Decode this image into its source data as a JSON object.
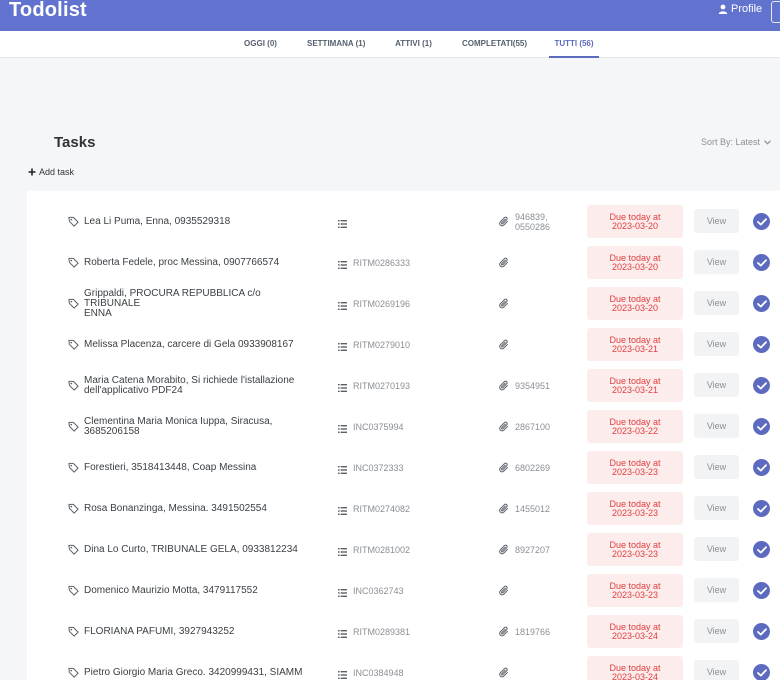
{
  "header": {
    "brand": "Todolist",
    "profile_label": "Profile"
  },
  "tabs": [
    {
      "label": "OGGI (0)",
      "active": false
    },
    {
      "label": "SETTIMANA (1)",
      "active": false
    },
    {
      "label": "ATTIVI (1)",
      "active": false
    },
    {
      "label": "COMPLETATI(55)",
      "active": false
    },
    {
      "label": "TUTTI (56)",
      "active": true
    }
  ],
  "page": {
    "title": "Tasks",
    "sort_label": "Sort By: Latest",
    "add_task_label": "Add task"
  },
  "colors": {
    "accent": "#5c6bc0",
    "topbar": "#6272cf",
    "due_bg": "#fcecec",
    "due_text": "#e03e3e"
  },
  "icons": [
    "user-icon",
    "chevron-down-icon",
    "plus-icon",
    "tag-icon",
    "list-icon",
    "paperclip-icon",
    "check-circle-icon"
  ],
  "tasks": [
    {
      "name_lines": [
        "Lea Li Puma, Enna, 0935529318"
      ],
      "code": "",
      "ref_lines": [
        "946839,",
        "0550286"
      ],
      "due_label": "Due today at",
      "due_date": "2023-03-20",
      "view_label": "View"
    },
    {
      "name_lines": [
        "Roberta Fedele, proc Messina, 0907766574"
      ],
      "code": "RITM0286333",
      "ref_lines": [],
      "due_label": "Due today at",
      "due_date": "2023-03-20",
      "view_label": "View"
    },
    {
      "name_lines": [
        "Grippaldi, PROCURA REPUBBLICA c/o TRIBUNALE",
        "ENNA"
      ],
      "code": "RITM0269196",
      "ref_lines": [],
      "due_label": "Due today at",
      "due_date": "2023-03-20",
      "view_label": "View"
    },
    {
      "name_lines": [
        "Melissa Placenza, carcere di Gela 0933908167"
      ],
      "code": "RITM0279010",
      "ref_lines": [],
      "due_label": "Due today at",
      "due_date": "2023-03-21",
      "view_label": "View"
    },
    {
      "name_lines": [
        "Maria Catena Morabito, Si richiede l'istallazione",
        "dell'applicativo PDF24"
      ],
      "code": "RITM0270193",
      "ref_lines": [
        "9354951"
      ],
      "due_label": "Due today at",
      "due_date": "2023-03-21",
      "view_label": "View"
    },
    {
      "name_lines": [
        "Clementina Maria Monica Iuppa, Siracusa,",
        "3685206158"
      ],
      "code": "INC0375994",
      "ref_lines": [
        "2867100"
      ],
      "due_label": "Due today at",
      "due_date": "2023-03-22",
      "view_label": "View"
    },
    {
      "name_lines": [
        "Forestieri, 3518413448, Coap Messina"
      ],
      "code": "INC0372333",
      "ref_lines": [
        "6802269"
      ],
      "due_label": "Due today at",
      "due_date": "2023-03-23",
      "view_label": "View"
    },
    {
      "name_lines": [
        "Rosa Bonanzinga, Messina. 3491502554"
      ],
      "code": "RITM0274082",
      "ref_lines": [
        "1455012"
      ],
      "due_label": "Due today at",
      "due_date": "2023-03-23",
      "view_label": "View"
    },
    {
      "name_lines": [
        "Dina Lo Curto, TRIBUNALE GELA, 0933812234"
      ],
      "code": "RITM0281002",
      "ref_lines": [
        "8927207"
      ],
      "due_label": "Due today at",
      "due_date": "2023-03-23",
      "view_label": "View"
    },
    {
      "name_lines": [
        "Domenico Maurizio Motta, 3479117552"
      ],
      "code": "INC0362743",
      "ref_lines": [],
      "due_label": "Due today at",
      "due_date": "2023-03-23",
      "view_label": "View"
    },
    {
      "name_lines": [
        "FLORIANA PAFUMI, 3927943252"
      ],
      "code": "RITM0289381",
      "ref_lines": [
        "1819766"
      ],
      "due_label": "Due today at",
      "due_date": "2023-03-24",
      "view_label": "View"
    },
    {
      "name_lines": [
        "Pietro Giorgio Maria Greco. 3420999431, SIAMM"
      ],
      "code": "INC0384948",
      "ref_lines": [],
      "due_label": "Due today at",
      "due_date": "2023-03-24",
      "view_label": "View"
    }
  ]
}
